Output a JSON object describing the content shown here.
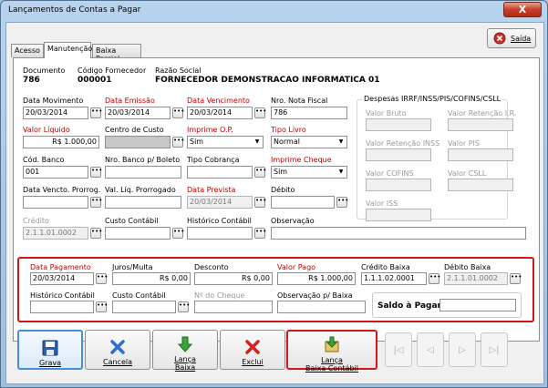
{
  "window": {
    "title": "Lançamentos de Contas a Pagar",
    "close_label": "X"
  },
  "saida": {
    "label": "Saída"
  },
  "tabs": [
    {
      "label": "Acesso"
    },
    {
      "label": "Manutenção"
    },
    {
      "label": "Baixa Parcial"
    }
  ],
  "header": {
    "documento_label": "Documento",
    "documento_value": "786",
    "fornecedor_label": "Código Fornecedor",
    "fornecedor_value": "000001",
    "razao_label": "Razão Social",
    "razao_value": "FORNECEDOR DEMONSTRACAO INFORMATICA 01"
  },
  "form": {
    "data_movimento": {
      "label": "Data Movimento",
      "value": "20/03/2014"
    },
    "data_emissao": {
      "label": "Data Emissão",
      "value": "20/03/2014"
    },
    "data_vencimento": {
      "label": "Data Vencimento",
      "value": "20/03/2014"
    },
    "nro_nota": {
      "label": "Nro. Nota Fiscal",
      "value": "786"
    },
    "valor_liquido": {
      "label": "Valor Líquido",
      "value": "R$ 1.000,00"
    },
    "centro_custo": {
      "label": "Centro de Custo",
      "value": ""
    },
    "imprime_op": {
      "label": "Imprime O.P.",
      "value": "Sim"
    },
    "tipo_livro": {
      "label": "Tipo Livro",
      "value": "Normal"
    },
    "cod_banco": {
      "label": "Cód. Banco",
      "value": "001"
    },
    "nro_banco": {
      "label": "Nro. Banco p/ Boleto",
      "value": ""
    },
    "tipo_cobranca": {
      "label": "Tipo Cobrança",
      "value": ""
    },
    "imprime_cheque": {
      "label": "Imprime Cheque",
      "value": "Sim"
    },
    "data_vencto_prorrog": {
      "label": "Data Vencto. Prorrog.",
      "value": ""
    },
    "val_liq_prorrogado": {
      "label": "Val. Líq. Prorrogado",
      "value": ""
    },
    "data_prevista": {
      "label": "Data Prevista",
      "value": "20/03/2014"
    },
    "debito": {
      "label": "Débito",
      "value": ""
    },
    "credito": {
      "label": "Crédito",
      "value": "2.1.1.01.0002"
    },
    "custo_contabil": {
      "label": "Custo Contábil",
      "value": ""
    },
    "historico_contabil": {
      "label": "Histórico Contábil",
      "value": ""
    },
    "observacao": {
      "label": "Observação",
      "value": ""
    }
  },
  "despesas": {
    "title": "Despesas IRRF/INSS/PIS/COFINS/CSLL",
    "valor_bruto": "Valor Bruto",
    "valor_retencao_ir": "Valor Retenção I.R.",
    "valor_retencao_inss": "Valor Retenção INSS",
    "valor_pis": "Valor PIS",
    "valor_cofins": "Valor COFINS",
    "valor_csll": "Valor CSLL",
    "valor_iss": "Valor ISS"
  },
  "baixa": {
    "data_pagamento": {
      "label": "Data Pagamento",
      "value": "20/03/2014"
    },
    "juros_multa": {
      "label": "Juros/Multa",
      "value": "R$ 0,00"
    },
    "desconto": {
      "label": "Desconto",
      "value": "R$ 0,00"
    },
    "valor_pago": {
      "label": "Valor Pago",
      "value": "R$ 1.000,00"
    },
    "credito_baixa": {
      "label": "Crédito Baixa",
      "value": "1.1.1.02.0001"
    },
    "debito_baixa": {
      "label": "Débito Baixa",
      "value": "2.1.1.01.0002"
    },
    "historico_contabil": {
      "label": "Histórico Contábil",
      "value": ""
    },
    "custo_contabil": {
      "label": "Custo Contábil",
      "value": ""
    },
    "nro_cheque": {
      "label": "Nº do Cheque",
      "value": ""
    },
    "observacao_baixa": {
      "label": "Observação p/ Baixa",
      "value": ""
    },
    "saldo_pagar": {
      "label": "Saldo à Pagar",
      "value": ""
    }
  },
  "toolbar": {
    "grava": "Grava",
    "cancela": "Cancela",
    "lanca_baixa_1": "Lança",
    "lanca_baixa_2": "Baixa",
    "exclui": "Exclui",
    "lanca_contabil_1": "Lança",
    "lanca_contabil_2": "Baixa Contábil"
  },
  "colors": {
    "accent_red": "#d01818",
    "label_red": "#c00000"
  }
}
